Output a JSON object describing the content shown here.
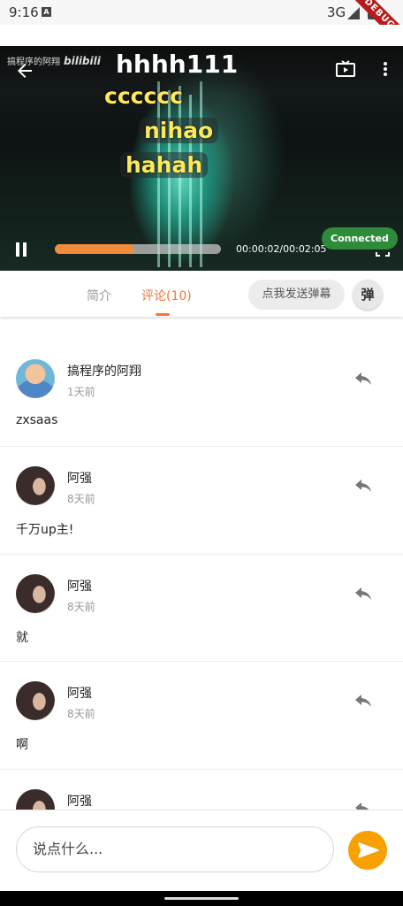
{
  "status_bar": {
    "time": "9:16",
    "notification_glyph": "A",
    "network": "3G",
    "debug_label": "DEBUG"
  },
  "video": {
    "watermark": "搞程序的阿翔",
    "watermark_logo": "bilibili",
    "title": "hhhh111",
    "danmaku": [
      "cccccc",
      "nihao",
      "hahah"
    ],
    "progress_fraction": 0.48,
    "time_readout": "00:00:02/00:02:05",
    "connected_label": "Connected",
    "colors": {
      "progress": "#f08c3c",
      "connected": "#2e8b3a",
      "danmaku": "#ffe95a"
    }
  },
  "tabs": {
    "items": [
      {
        "label": "简介",
        "active": false
      },
      {
        "label": "评论(10)",
        "active": true
      }
    ],
    "danmu_send_label": "点我发送弹幕",
    "danmu_toggle_label": "弹",
    "accent": "#f0793a"
  },
  "comments": [
    {
      "author": "搞程序的阿翔",
      "time": "1天前",
      "content": "zxsaas",
      "avatar": "cartoon"
    },
    {
      "author": "阿强",
      "time": "8天前",
      "content": "千万up主!",
      "avatar": "photo"
    },
    {
      "author": "阿强",
      "time": "8天前",
      "content": "就",
      "avatar": "photo"
    },
    {
      "author": "阿强",
      "time": "8天前",
      "content": "啊",
      "avatar": "photo"
    },
    {
      "author": "阿强",
      "time": "",
      "content": "",
      "avatar": "photo"
    }
  ],
  "input": {
    "placeholder": "说点什么...",
    "send_color": "#f8a000"
  }
}
